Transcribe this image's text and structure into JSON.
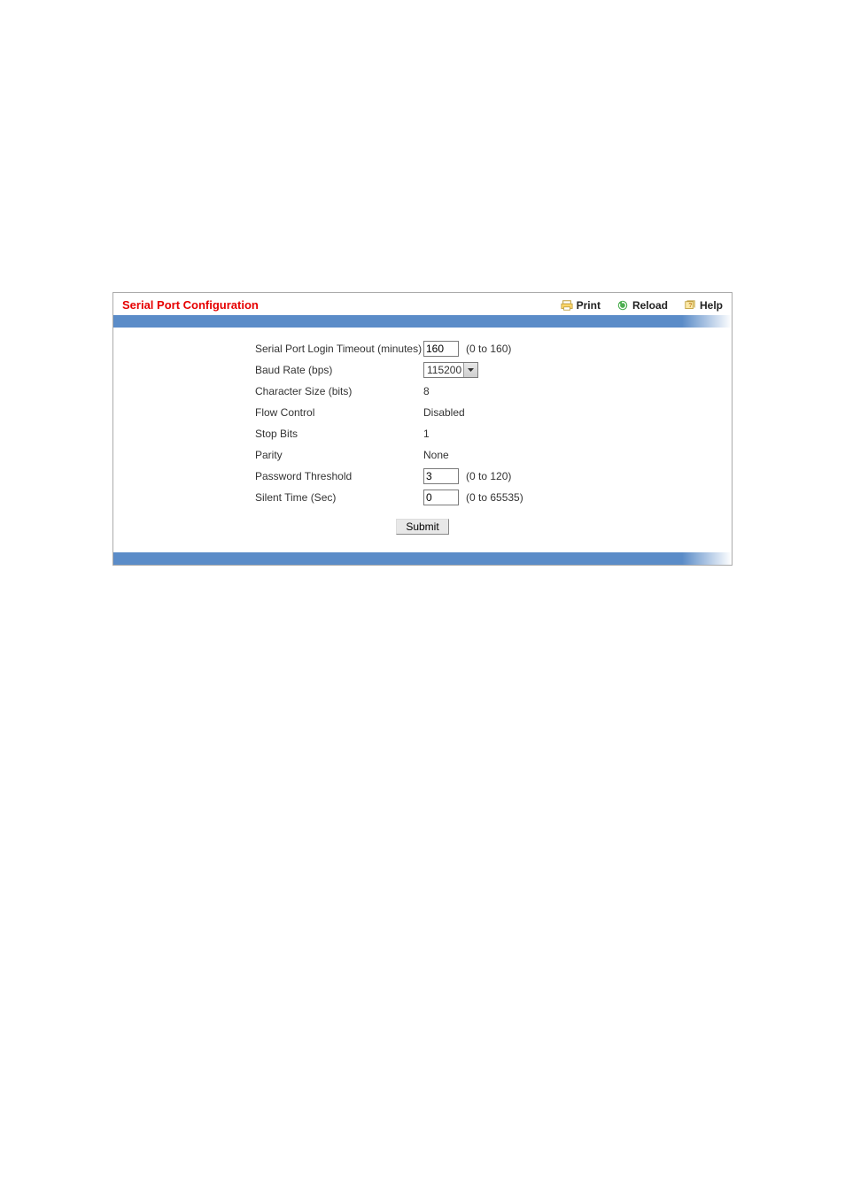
{
  "header": {
    "title": "Serial Port Configuration",
    "actions": {
      "print": "Print",
      "reload": "Reload",
      "help": "Help"
    }
  },
  "form": {
    "rows": [
      {
        "label": "Serial Port Login Timeout (minutes)",
        "type": "input",
        "value": "160",
        "hint": "(0 to 160)"
      },
      {
        "label": "Baud Rate (bps)",
        "type": "select",
        "value": "115200"
      },
      {
        "label": "Character Size (bits)",
        "type": "static",
        "value": "8"
      },
      {
        "label": "Flow Control",
        "type": "static",
        "value": "Disabled"
      },
      {
        "label": "Stop Bits",
        "type": "static",
        "value": "1"
      },
      {
        "label": "Parity",
        "type": "static",
        "value": "None"
      },
      {
        "label": "Password Threshold",
        "type": "input",
        "value": "3",
        "hint": "(0 to 120)"
      },
      {
        "label": "Silent Time (Sec)",
        "type": "input",
        "value": "0",
        "hint": "(0 to 65535)"
      }
    ],
    "submit_label": "Submit"
  }
}
